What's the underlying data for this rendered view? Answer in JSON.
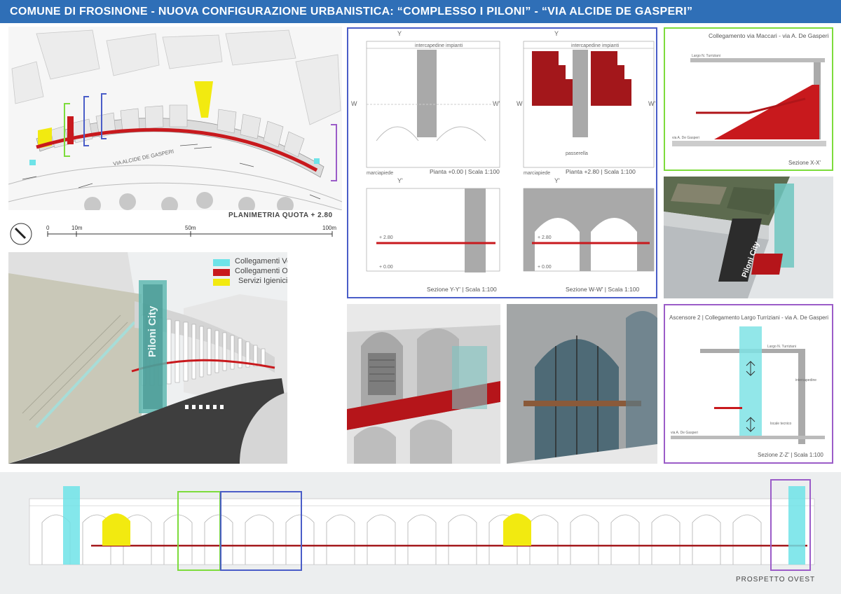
{
  "header": {
    "title": "COMUNE DI FROSINONE - NUOVA CONFIGURAZIONE URBANISTICA:  “COMPLESSO I PILONI” - “VIA ALCIDE DE GASPERI”"
  },
  "site_plan": {
    "street_label": "VIA ALCIDE DE GASPERI",
    "caption": "PLANIMETRIA QUOTA + 2.80",
    "scale_ticks": [
      "0",
      "10m",
      "50m",
      "100m"
    ]
  },
  "render_main": {
    "legend": [
      {
        "label": "Collegamenti Verticali",
        "color": "#6ee3e8"
      },
      {
        "label": "Collegamenti Orizzontali",
        "color": "#c8191d"
      },
      {
        "label": "Servizi Igienici",
        "color": "#f2ea10"
      }
    ],
    "tower_sign": "Piloni City"
  },
  "plans": {
    "plan1": {
      "caption": "Pianta +0.00 | Scala 1:100",
      "top_label": "intercapedine impianti",
      "axis_y": "Y",
      "axis_y2": "Y'",
      "axis_w": "W",
      "axis_w2": "W'",
      "walk_label": "marciapiede"
    },
    "plan2": {
      "caption": "Pianta  +2.80 | Scala 1:100",
      "top_label": "intercapedine impianti",
      "axis_y": "Y",
      "axis_y2": "Y'",
      "axis_w": "W",
      "axis_w2": "W'",
      "walk_label": "marciapiede",
      "bridge_label": "passerella"
    },
    "section1": {
      "caption": "Sezione Y-Y' | Scala 1:100",
      "level_high": "+ 2.80",
      "level_low": "+ 0.00"
    },
    "section2": {
      "caption": "Sezione W-W' | Scala 1:100",
      "level_high": "+ 2.80",
      "level_low": "+ 0.00"
    }
  },
  "section_x": {
    "title": "Collegamento via Maccari - via A. De Gasperi",
    "caption": "Sezione X-X'",
    "top_label": "Largo N. Turriziani",
    "bottom_label": "via A. De Gasperi"
  },
  "render_corner": {
    "tower_sign": "Piloni City"
  },
  "section_z": {
    "title": "Ascensore 2 | Collegamento Largo Turriziani - via A. De Gasperi",
    "caption": "Sezione Z-Z' | Scala 1:100",
    "top_label": "Largo N. Turriziani",
    "mid_label": "intercapedine",
    "bottom_label": "via A. De Gasperi",
    "right_label": "locale tecnico"
  },
  "elevation": {
    "caption": "PROSPETTO OVEST"
  },
  "colors": {
    "title_bar": "#2f6fb7",
    "frame_blue": "#4a5dc8",
    "frame_green": "#7ddc3c",
    "frame_purple": "#9b5cc8",
    "vertical": "#6ee3e8",
    "horizontal": "#c8191d",
    "services": "#f2ea10"
  }
}
